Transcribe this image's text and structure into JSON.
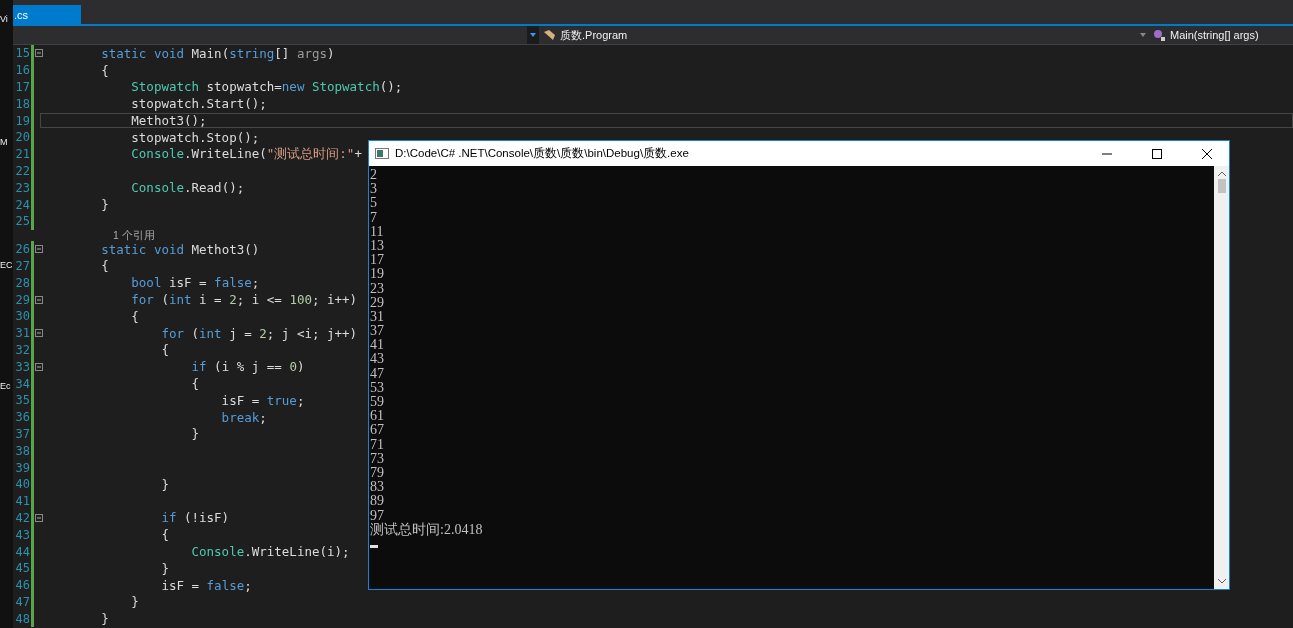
{
  "desktop_fragments": [
    "Vi",
    "M",
    "EC",
    "Ec"
  ],
  "tab": {
    "label": ".cs",
    "selected": true
  },
  "nav": {
    "type_dropdown": "质数.Program",
    "member_dropdown": "Main(string[] args)"
  },
  "editor": {
    "lines": [
      {
        "num": "15",
        "fold": true,
        "current": false,
        "tokens": [
          {
            "kind": "kw",
            "text": "        static void"
          },
          {
            "kind": "plain",
            "text": " Main("
          },
          {
            "kind": "kw",
            "text": "string"
          },
          {
            "kind": "plain",
            "text": "[] "
          },
          {
            "kind": "dim",
            "text": "args"
          },
          {
            "kind": "plain",
            "text": ")"
          }
        ]
      },
      {
        "num": "16",
        "fold": false,
        "current": false,
        "tokens": [
          {
            "kind": "plain",
            "text": "        {"
          }
        ]
      },
      {
        "num": "17",
        "fold": false,
        "current": false,
        "tokens": [
          {
            "kind": "type",
            "text": "            Stopwatch"
          },
          {
            "kind": "plain",
            "text": " stopwatch="
          },
          {
            "kind": "kw",
            "text": "new"
          },
          {
            "kind": "type",
            "text": " Stopwatch"
          },
          {
            "kind": "plain",
            "text": "();"
          }
        ]
      },
      {
        "num": "18",
        "fold": false,
        "current": false,
        "tokens": [
          {
            "kind": "plain",
            "text": "            stopwatch.Start();"
          }
        ]
      },
      {
        "num": "19",
        "fold": false,
        "current": true,
        "tokens": [
          {
            "kind": "plain",
            "text": "            Methot3();"
          }
        ]
      },
      {
        "num": "20",
        "fold": false,
        "current": false,
        "tokens": [
          {
            "kind": "plain",
            "text": "            stopwatch.Stop();"
          }
        ]
      },
      {
        "num": "21",
        "fold": false,
        "current": false,
        "tokens": [
          {
            "kind": "type",
            "text": "            Console"
          },
          {
            "kind": "plain",
            "text": ".WriteLine("
          },
          {
            "kind": "str",
            "text": "\"测试总时间:\""
          },
          {
            "kind": "plain",
            "text": "+"
          }
        ]
      },
      {
        "num": "22",
        "fold": false,
        "current": false
      },
      {
        "num": "23",
        "fold": false,
        "current": false,
        "tokens": [
          {
            "kind": "type",
            "text": "            Console"
          },
          {
            "kind": "plain",
            "text": ".Read();"
          }
        ]
      },
      {
        "num": "24",
        "fold": false,
        "current": false,
        "tokens": [
          {
            "kind": "plain",
            "text": "        }"
          }
        ]
      },
      {
        "num": "25",
        "fold": false,
        "current": false
      },
      {
        "num": "26",
        "fold": true,
        "current": false,
        "lens": "1 个引用",
        "tokens": [
          {
            "kind": "kw",
            "text": "        static void"
          },
          {
            "kind": "plain",
            "text": " Methot3()"
          }
        ]
      },
      {
        "num": "27",
        "fold": false,
        "current": false,
        "tokens": [
          {
            "kind": "plain",
            "text": "        {"
          }
        ]
      },
      {
        "num": "28",
        "fold": false,
        "current": false,
        "tokens": [
          {
            "kind": "kw",
            "text": "            bool"
          },
          {
            "kind": "plain",
            "text": " isF = "
          },
          {
            "kind": "kw",
            "text": "false"
          },
          {
            "kind": "plain",
            "text": ";"
          }
        ]
      },
      {
        "num": "29",
        "fold": true,
        "current": false,
        "tokens": [
          {
            "kind": "kw",
            "text": "            for"
          },
          {
            "kind": "plain",
            "text": " ("
          },
          {
            "kind": "kw",
            "text": "int"
          },
          {
            "kind": "plain",
            "text": " i = "
          },
          {
            "kind": "num",
            "text": "2"
          },
          {
            "kind": "plain",
            "text": "; i <= "
          },
          {
            "kind": "num",
            "text": "100"
          },
          {
            "kind": "plain",
            "text": "; i++)"
          }
        ]
      },
      {
        "num": "30",
        "fold": false,
        "current": false,
        "tokens": [
          {
            "kind": "plain",
            "text": "            {"
          }
        ]
      },
      {
        "num": "31",
        "fold": true,
        "current": false,
        "tokens": [
          {
            "kind": "kw",
            "text": "                for"
          },
          {
            "kind": "plain",
            "text": " ("
          },
          {
            "kind": "kw",
            "text": "int"
          },
          {
            "kind": "plain",
            "text": " j = "
          },
          {
            "kind": "num",
            "text": "2"
          },
          {
            "kind": "plain",
            "text": "; j <i; j++)"
          }
        ]
      },
      {
        "num": "32",
        "fold": false,
        "current": false,
        "tokens": [
          {
            "kind": "plain",
            "text": "                {"
          }
        ]
      },
      {
        "num": "33",
        "fold": true,
        "current": false,
        "tokens": [
          {
            "kind": "kw",
            "text": "                    if"
          },
          {
            "kind": "plain",
            "text": " (i % j == "
          },
          {
            "kind": "num",
            "text": "0"
          },
          {
            "kind": "plain",
            "text": ")"
          }
        ]
      },
      {
        "num": "34",
        "fold": false,
        "current": false,
        "tokens": [
          {
            "kind": "plain",
            "text": "                    {"
          }
        ]
      },
      {
        "num": "35",
        "fold": false,
        "current": false,
        "tokens": [
          {
            "kind": "plain",
            "text": "                        isF = "
          },
          {
            "kind": "kw",
            "text": "true"
          },
          {
            "kind": "plain",
            "text": ";"
          }
        ]
      },
      {
        "num": "36",
        "fold": false,
        "current": false,
        "tokens": [
          {
            "kind": "kw",
            "text": "                        break"
          },
          {
            "kind": "plain",
            "text": ";"
          }
        ]
      },
      {
        "num": "37",
        "fold": false,
        "current": false,
        "tokens": [
          {
            "kind": "plain",
            "text": "                    }"
          }
        ]
      },
      {
        "num": "38",
        "fold": false,
        "current": false
      },
      {
        "num": "39",
        "fold": false,
        "current": false
      },
      {
        "num": "40",
        "fold": false,
        "current": false,
        "tokens": [
          {
            "kind": "plain",
            "text": "                }"
          }
        ]
      },
      {
        "num": "41",
        "fold": false,
        "current": false
      },
      {
        "num": "42",
        "fold": true,
        "current": false,
        "tokens": [
          {
            "kind": "kw",
            "text": "                if"
          },
          {
            "kind": "plain",
            "text": " (!isF)"
          }
        ]
      },
      {
        "num": "43",
        "fold": false,
        "current": false,
        "tokens": [
          {
            "kind": "plain",
            "text": "                {"
          }
        ]
      },
      {
        "num": "44",
        "fold": false,
        "current": false,
        "tokens": [
          {
            "kind": "type",
            "text": "                    Console"
          },
          {
            "kind": "plain",
            "text": ".WriteLine(i);"
          }
        ]
      },
      {
        "num": "45",
        "fold": false,
        "current": false,
        "tokens": [
          {
            "kind": "plain",
            "text": "                }"
          }
        ]
      },
      {
        "num": "46",
        "fold": false,
        "current": false,
        "tokens": [
          {
            "kind": "plain",
            "text": "                isF = "
          },
          {
            "kind": "kw",
            "text": "false"
          },
          {
            "kind": "plain",
            "text": ";"
          }
        ]
      },
      {
        "num": "47",
        "fold": false,
        "current": false,
        "tokens": [
          {
            "kind": "plain",
            "text": "            }"
          }
        ]
      },
      {
        "num": "48",
        "fold": false,
        "current": false,
        "tokens": [
          {
            "kind": "plain",
            "text": "        }"
          }
        ]
      }
    ]
  },
  "console": {
    "title": "D:\\Code\\C# .NET\\Console\\质数\\质数\\bin\\Debug\\质数.exe",
    "output": [
      "2",
      "3",
      "5",
      "7",
      "11",
      "13",
      "17",
      "19",
      "23",
      "29",
      "31",
      "37",
      "41",
      "43",
      "47",
      "53",
      "59",
      "61",
      "67",
      "71",
      "73",
      "79",
      "83",
      "89",
      "97",
      "测试总时间:2.0418"
    ],
    "cursor": true
  }
}
